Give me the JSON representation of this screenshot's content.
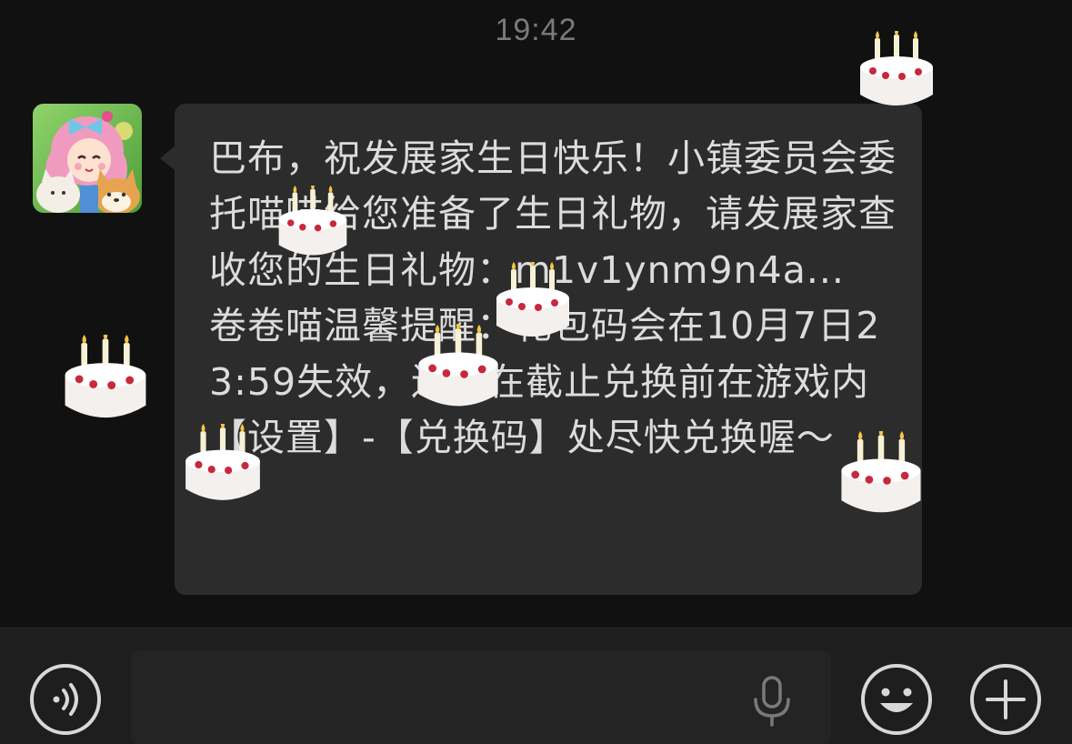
{
  "status": {
    "time": "19:42"
  },
  "chat": {
    "message": {
      "sender_avatar_icon": "game-avatar-girl-cat-dog",
      "text": "巴布，祝发展家生日快乐！小镇委员会委托喵喵给您准备了生日礼物，请发展家查收您的生日礼物：m1v1ynm9n4a...\n卷卷喵温馨提醒：礼包码会在10月7日23:59失效，还请在截止兑换前在游戏内【设置】-【兑换码】处尽快兑换喔～"
    },
    "effects": {
      "icon": "birthday-cake-icon"
    }
  },
  "input_bar": {
    "voice_icon": "voice-toggle-icon",
    "mic_icon": "microphone-icon",
    "emoji_icon": "emoji-icon",
    "plus_icon": "plus-icon",
    "input_value": ""
  },
  "colors": {
    "background": "#111111",
    "bubble": "#2c2c2c",
    "text": "#dcdcdc",
    "timestamp": "#7a7a7a",
    "icon": "#d8d8d8"
  }
}
